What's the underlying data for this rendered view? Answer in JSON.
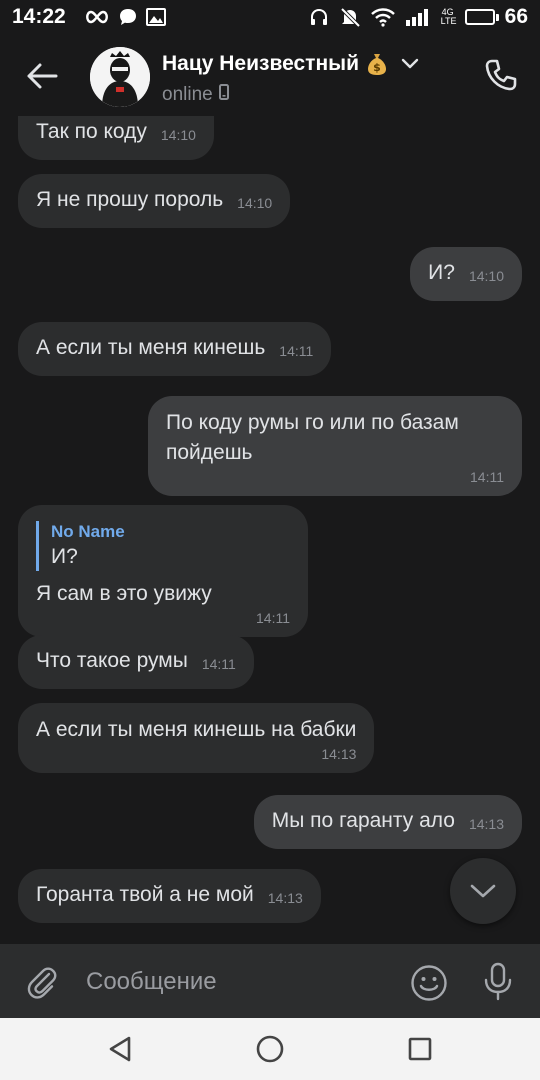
{
  "status_bar": {
    "time": "14:22",
    "network_label_top": "4G",
    "network_label_bottom": "LTE",
    "battery_level": "66",
    "battery_fraction": 0.66
  },
  "header": {
    "peer_name": "Нацу Неизвестный",
    "peer_status": "online",
    "icons": {
      "back": "arrow-left-icon",
      "money": "money-bag-icon",
      "expand": "chevron-down-icon",
      "device": "mobile-phone-icon",
      "call": "phone-icon"
    }
  },
  "messages": [
    {
      "dir": "in",
      "text": "Так по коду",
      "time": "14:10"
    },
    {
      "dir": "in",
      "text": "Я не прошу пороль",
      "time": "14:10"
    },
    {
      "dir": "out",
      "text": "И?",
      "time": "14:10"
    },
    {
      "dir": "in",
      "text": "А если ты меня кинешь",
      "time": "14:11"
    },
    {
      "dir": "out",
      "text_lines": [
        "По коду румы го или по базам",
        "пойдешь"
      ],
      "time": "14:11"
    },
    {
      "dir": "in",
      "reply": {
        "author": "No Name",
        "text": "И?"
      },
      "text": "Я сам в это увижу",
      "time": "14:11"
    },
    {
      "dir": "in",
      "text": "Что такое румы",
      "time": "14:11"
    },
    {
      "dir": "in",
      "text": "А если ты меня кинешь на бабки",
      "time": "14:13"
    },
    {
      "dir": "out",
      "text": "Мы по гаранту ало",
      "time": "14:13"
    },
    {
      "dir": "in",
      "text": "Горанта твой а не мой",
      "time": "14:13"
    }
  ],
  "composer": {
    "placeholder": "Сообщение",
    "icons": {
      "attach": "paperclip-icon",
      "emoji": "smiley-icon",
      "mic": "microphone-icon"
    }
  },
  "colors": {
    "background": "#19191a",
    "incoming_bubble": "#2c2d2e",
    "outgoing_bubble": "#3d3e40",
    "reply_accent": "#71aaeb",
    "timestamp": "#8a8d93"
  }
}
